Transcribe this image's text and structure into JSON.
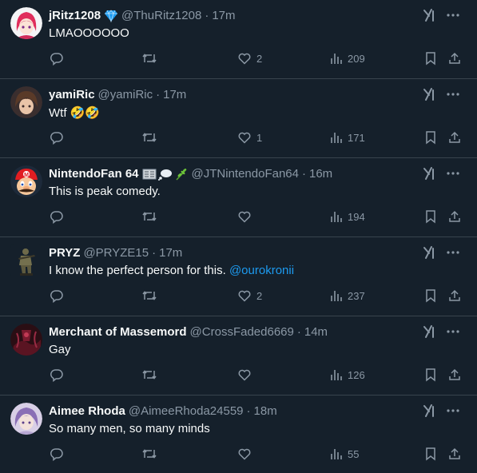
{
  "colors": {
    "background": "#15202b",
    "divider": "#38444d",
    "text_primary": "#f7f9f9",
    "text_secondary": "#8b98a5",
    "link": "#1d9bf0",
    "verified_badge": "#1d9bf0"
  },
  "tweets": [
    {
      "name": "jRitz1208",
      "handle": "@ThuRitz1208",
      "separator": "·",
      "time": "17m",
      "badge": "verified-diamond-icon",
      "text": "LMAOOOOOO",
      "likes": "2",
      "views": "209",
      "avatar": "anime-girl-avatar"
    },
    {
      "name": "yamiRic",
      "handle": "@yamiRic",
      "separator": "·",
      "time": "17m",
      "text": "Wtf",
      "text_emoji": "🤣🤣",
      "likes": "1",
      "views": "171",
      "avatar": "anime-avatar"
    },
    {
      "name": "NintendoFan 64",
      "handle": "@JTNintendoFan64",
      "separator": "·",
      "time": "16m",
      "name_emojis": "📰💭🌿",
      "text": "This is peak comedy.",
      "likes": "",
      "views": "194",
      "avatar": "mario-avatar"
    },
    {
      "name": "PRYZ",
      "handle": "@PRYZE15",
      "separator": "·",
      "time": "17m",
      "text": "I know the perfect person for this.",
      "mention": "@ourokronii",
      "likes": "2",
      "views": "237",
      "avatar": "soldier-figure-avatar"
    },
    {
      "name": "Merchant of Massemord",
      "handle": "@CrossFaded6669",
      "separator": "·",
      "time": "14m",
      "text": "Gay",
      "likes": "",
      "views": "126",
      "avatar": "dark-red-avatar"
    },
    {
      "name": "Aimee Rhoda",
      "handle": "@AimeeRhoda24559",
      "separator": "·",
      "time": "18m",
      "text": "So many men, so many minds",
      "likes": "",
      "views": "55",
      "avatar": "purple-anime-avatar"
    }
  ]
}
